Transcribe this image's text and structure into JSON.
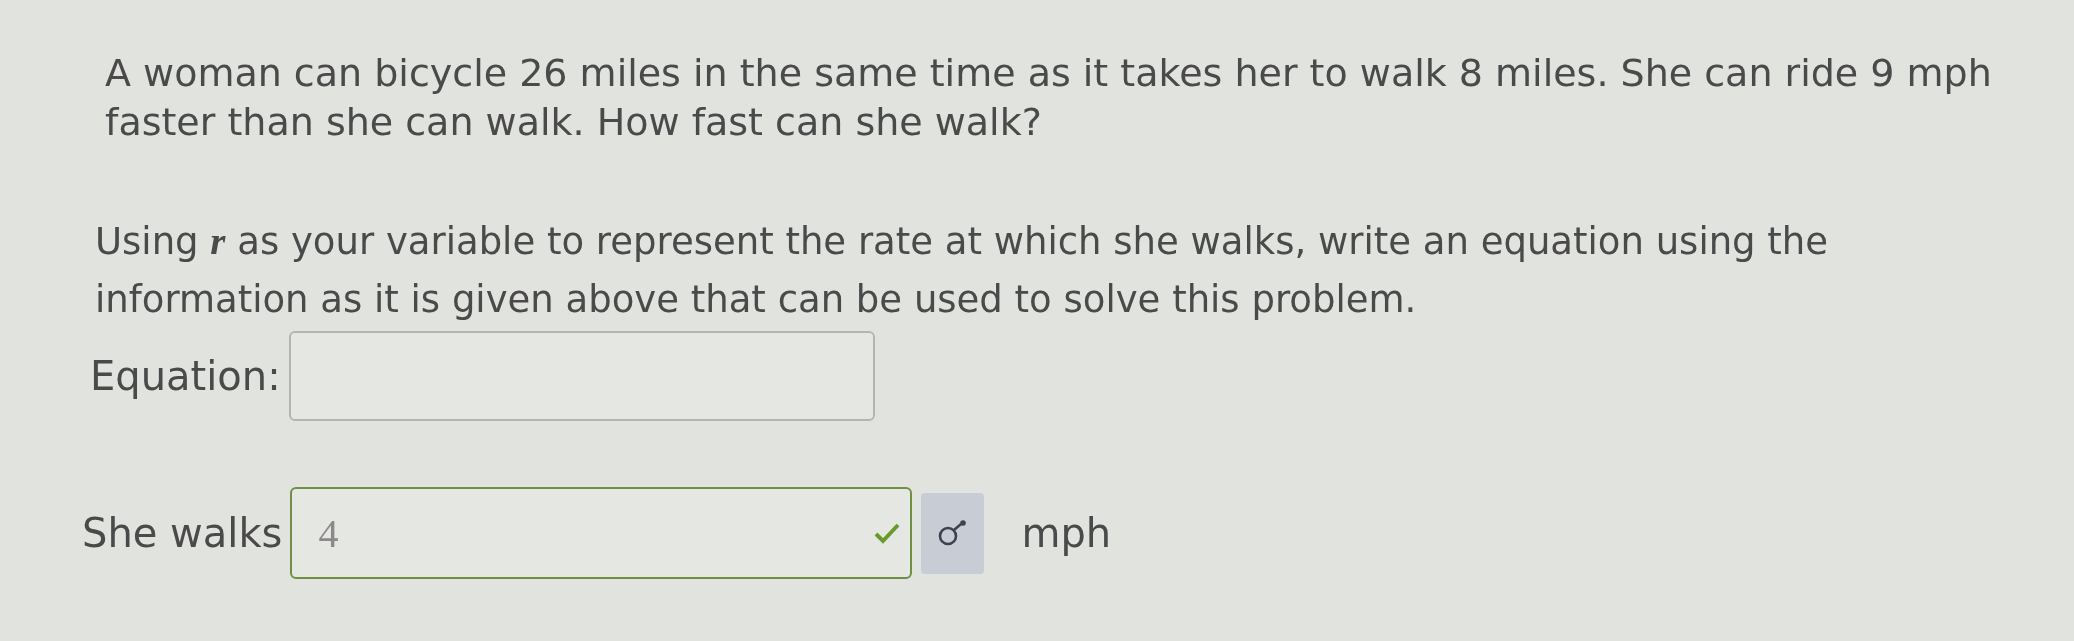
{
  "problem": {
    "text": "A woman can bicycle 26 miles in the same time as it takes her to walk 8 miles. She can ride 9 mph faster than she can walk. How fast can she walk?"
  },
  "instruction": {
    "text": "Using **r** as your variable to represent the rate at which she walks, write an equation using the information as it is given above that can be used to solve this problem."
  },
  "equation": {
    "label": "Equation:"
  },
  "answer": {
    "label": "She walks",
    "value": "4",
    "correct": true,
    "unit": "mph"
  }
}
